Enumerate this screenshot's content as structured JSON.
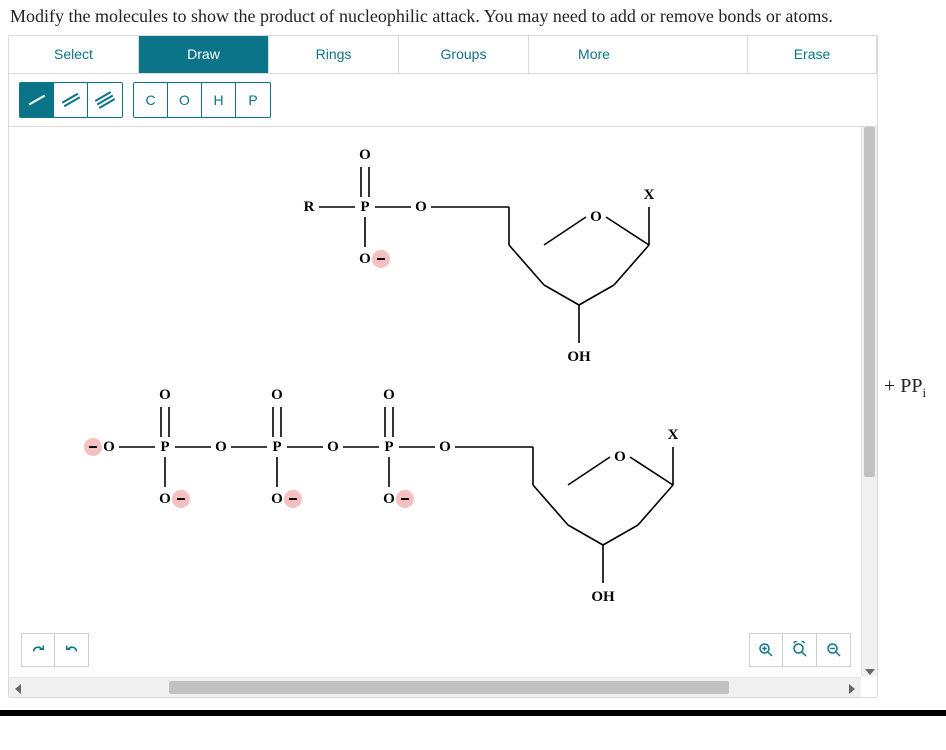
{
  "prompt": "Modify the molecules to show the product of nucleophilic attack. You may need to add or remove bonds or atoms.",
  "tabs": {
    "select": "Select",
    "draw": "Draw",
    "rings": "Rings",
    "groups": "Groups",
    "more": "More",
    "erase": "Erase",
    "active": "draw"
  },
  "bond_tools": {
    "single": "single-bond",
    "double": "double-bond",
    "triple": "triple-bond",
    "active": "single"
  },
  "element_tools": [
    "C",
    "O",
    "H",
    "P"
  ],
  "canvas": {
    "atoms": {
      "O": "O",
      "P": "P",
      "R": "R",
      "X": "X",
      "OH": "OH",
      "O_minus": "O",
      "minus": "−"
    },
    "molecules": [
      {
        "id": "top-product",
        "desc": "R–phosphate–O–sugar(OH, O, X)",
        "phosphates": [
          {
            "left": "R",
            "has_dbl_O": true,
            "has_neg_O": true
          }
        ],
        "sugar": {
          "OH_below": true,
          "O_in_ring": true,
          "X_top_right": true
        }
      },
      {
        "id": "bottom-triphosphate",
        "desc": "O–P(=O)(O⁻)–O–P(=O)(O⁻)–O–P(=O)(O⁻)–O–sugar(OH, O, X)",
        "phosphates": [
          {
            "left": "O",
            "left_neg": true,
            "has_dbl_O": true,
            "has_neg_O": true
          },
          {
            "has_dbl_O": true,
            "has_neg_O": true
          },
          {
            "has_dbl_O": true,
            "has_neg_O": true
          }
        ],
        "sugar": {
          "OH_below": true,
          "O_in_ring": true,
          "X_top_right": true
        }
      }
    ]
  },
  "side_text": {
    "plus": "+ ",
    "pp": "PP",
    "sub": "i"
  },
  "bottom_buttons": {
    "redo": "redo-icon",
    "undo": "undo-icon",
    "zoom_in": "zoom-in-icon",
    "zoom_fit": "zoom-fit-icon",
    "zoom_out": "zoom-out-icon"
  }
}
